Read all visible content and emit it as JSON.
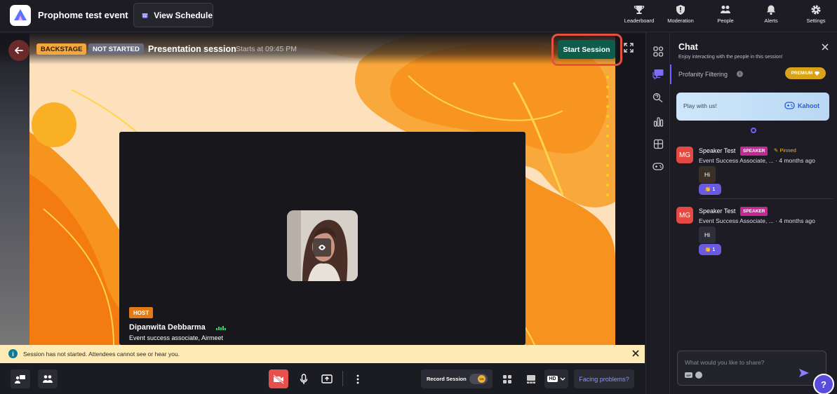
{
  "header": {
    "event_title": "Prophome test event",
    "view_schedule": "View Schedule",
    "nav": [
      {
        "label": "Leaderboard",
        "icon": "trophy-icon"
      },
      {
        "label": "Moderation",
        "icon": "shield-icon"
      },
      {
        "label": "People",
        "icon": "people-icon"
      },
      {
        "label": "Alerts",
        "icon": "bell-icon"
      },
      {
        "label": "Settings",
        "icon": "gear-icon"
      }
    ]
  },
  "stage": {
    "badge_backstage": "BACKSTAGE",
    "badge_status": "NOT STARTED",
    "session_title": "Presentation session",
    "starts_at": "Starts at 09:45 PM",
    "start_button": "Start Session",
    "host": {
      "badge": "HOST",
      "name": "Dipanwita Debbarma",
      "role": "Event success associate, Airmeet"
    }
  },
  "notice": {
    "text": "Session has not started. Attendees cannot see or hear you."
  },
  "controls": {
    "record_label": "Record Session",
    "record_toggle": "ON",
    "quality": "HD",
    "facing_problems": "Facing problems?"
  },
  "chat": {
    "title": "Chat",
    "subtitle": "Enjoy interacting with the people in this session!",
    "profanity_label": "Profanity Filtering",
    "premium_label": "PREMIUM",
    "kahoot_play": "Play with us!",
    "kahoot_brand": "Kahoot",
    "messages": [
      {
        "initials": "MG",
        "name": "Speaker Test",
        "badge": "SPEAKER",
        "pinned": "Pinned",
        "org": "Event Success Associate, ...",
        "time": "4 months ago",
        "text": "Hi",
        "reaction_count": "1"
      },
      {
        "initials": "MG",
        "name": "Speaker Test",
        "badge": "SPEAKER",
        "org": "Event Success Associate, ...",
        "time": "4 months ago",
        "text": "Hi",
        "reaction_count": "1"
      }
    ],
    "compose_placeholder": "What would you like to share?",
    "gif_label": "GIF"
  },
  "colors": {
    "accent": "#6a5ae0",
    "start_button": "#0e5c4b",
    "highlight": "#e5503f",
    "speaker_badge": "#c42892",
    "premium": "#d8a21b"
  }
}
